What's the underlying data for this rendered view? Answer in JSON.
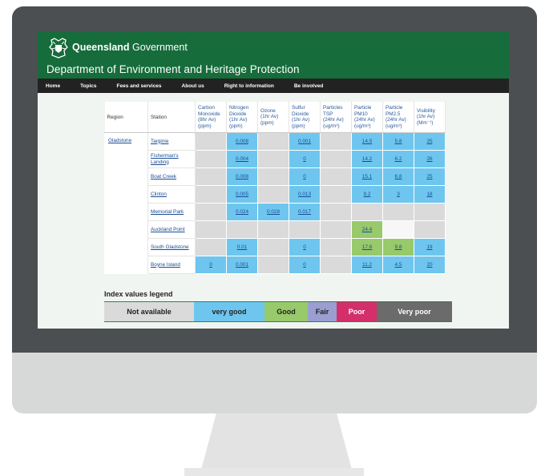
{
  "header": {
    "brand_bold": "Queensland",
    "brand_rest": " Government",
    "department": "Department of Environment and Heritage Protection"
  },
  "nav": [
    "Home",
    "Topics",
    "Fees and services",
    "About us",
    "Right to information",
    "Be involved"
  ],
  "table": {
    "col_region": "Region",
    "col_station": "Station",
    "params": [
      [
        "Carbon",
        "Monoxide",
        "(8hr Av)",
        "(ppm)"
      ],
      [
        "Nitrogen",
        "Dioxide",
        "(1hr Av)",
        "(ppm)"
      ],
      [
        "Ozone",
        "(1hr Av)",
        "(ppm)"
      ],
      [
        "Sulfur",
        "Dioxide",
        "(1hr Av)",
        "(ppm)"
      ],
      [
        "Particles",
        "TSP",
        "(24hr Av)",
        "(ug/m³)"
      ],
      [
        "Particle",
        "PM10",
        "(24hr Av)",
        "(ug/m³)"
      ],
      [
        "Particle",
        "PM2.5",
        "(24hr Av)",
        "(ug/m³)"
      ],
      [
        "Visibility",
        "(1hr Av)",
        "(Mm⁻¹)"
      ]
    ],
    "region": "Gladstone",
    "rows": [
      {
        "station": "Targinie",
        "cells": [
          {
            "s": "na",
            "v": ""
          },
          {
            "s": "vg",
            "v": "0.008"
          },
          {
            "s": "na",
            "v": ""
          },
          {
            "s": "vg",
            "v": "0.001"
          },
          {
            "s": "na",
            "v": ""
          },
          {
            "s": "vg",
            "v": "14.5"
          },
          {
            "s": "vg",
            "v": "5.8"
          },
          {
            "s": "vg",
            "v": "25"
          }
        ]
      },
      {
        "station": "Fisherman's Landing",
        "cells": [
          {
            "s": "na",
            "v": ""
          },
          {
            "s": "vg",
            "v": "0.004"
          },
          {
            "s": "na",
            "v": ""
          },
          {
            "s": "vg",
            "v": "0"
          },
          {
            "s": "na",
            "v": ""
          },
          {
            "s": "vg",
            "v": "14.2"
          },
          {
            "s": "vg",
            "v": "6.2"
          },
          {
            "s": "vg",
            "v": "26"
          }
        ]
      },
      {
        "station": "Boat Creek",
        "cells": [
          {
            "s": "na",
            "v": ""
          },
          {
            "s": "vg",
            "v": "0.008"
          },
          {
            "s": "na",
            "v": ""
          },
          {
            "s": "vg",
            "v": "0"
          },
          {
            "s": "na",
            "v": ""
          },
          {
            "s": "vg",
            "v": "15.1"
          },
          {
            "s": "vg",
            "v": "6.8"
          },
          {
            "s": "vg",
            "v": "25"
          }
        ]
      },
      {
        "station": "Clinton",
        "cells": [
          {
            "s": "na",
            "v": ""
          },
          {
            "s": "vg",
            "v": "0.005"
          },
          {
            "s": "na",
            "v": ""
          },
          {
            "s": "vg",
            "v": "0.013"
          },
          {
            "s": "na",
            "v": ""
          },
          {
            "s": "vg",
            "v": "9.2"
          },
          {
            "s": "vg",
            "v": "3"
          },
          {
            "s": "vg",
            "v": "18"
          }
        ]
      },
      {
        "station": "Memorial Park",
        "cells": [
          {
            "s": "na",
            "v": ""
          },
          {
            "s": "vg",
            "v": "0.024"
          },
          {
            "s": "vg",
            "v": "0.028"
          },
          {
            "s": "vg",
            "v": "0.017"
          },
          {
            "s": "na",
            "v": ""
          },
          {
            "s": "na",
            "v": ""
          },
          {
            "s": "na",
            "v": ""
          },
          {
            "s": "na",
            "v": ""
          }
        ]
      },
      {
        "station": "Auckland Point",
        "cells": [
          {
            "s": "na",
            "v": ""
          },
          {
            "s": "na",
            "v": ""
          },
          {
            "s": "na",
            "v": ""
          },
          {
            "s": "na",
            "v": ""
          },
          {
            "s": "na",
            "v": ""
          },
          {
            "s": "gd",
            "v": "24.4"
          },
          {
            "s": "empty",
            "v": ""
          },
          {
            "s": "na",
            "v": ""
          }
        ]
      },
      {
        "station": "South Gladstone",
        "cells": [
          {
            "s": "na",
            "v": ""
          },
          {
            "s": "vg",
            "v": "0.01"
          },
          {
            "s": "na",
            "v": ""
          },
          {
            "s": "vg",
            "v": "0"
          },
          {
            "s": "na",
            "v": ""
          },
          {
            "s": "gd",
            "v": "17.6"
          },
          {
            "s": "gd",
            "v": "9.8"
          },
          {
            "s": "vg",
            "v": "19"
          }
        ]
      },
      {
        "station": "Boyne Island",
        "cells": [
          {
            "s": "vg",
            "v": "0"
          },
          {
            "s": "vg",
            "v": "0.001"
          },
          {
            "s": "na",
            "v": ""
          },
          {
            "s": "vg",
            "v": "0"
          },
          {
            "s": "na",
            "v": ""
          },
          {
            "s": "vg",
            "v": "11.2"
          },
          {
            "s": "vg",
            "v": "4.5"
          },
          {
            "s": "vg",
            "v": "20"
          }
        ]
      }
    ]
  },
  "legend": {
    "title": "Index values legend",
    "items": [
      {
        "label": "Not available",
        "color": "#dadada"
      },
      {
        "label": "very good",
        "color": "#6ec6ef"
      },
      {
        "label": "Good",
        "color": "#98c96a"
      },
      {
        "label": "Fair",
        "color": "#9a9ed0"
      },
      {
        "label": "Poor",
        "color": "#d42f6b"
      },
      {
        "label": "Very poor",
        "color": "#6b6b6b"
      }
    ]
  },
  "colors": {
    "brand_green": "#166c3b",
    "nav_bg": "#222222",
    "bezel": "#4b4f52"
  }
}
